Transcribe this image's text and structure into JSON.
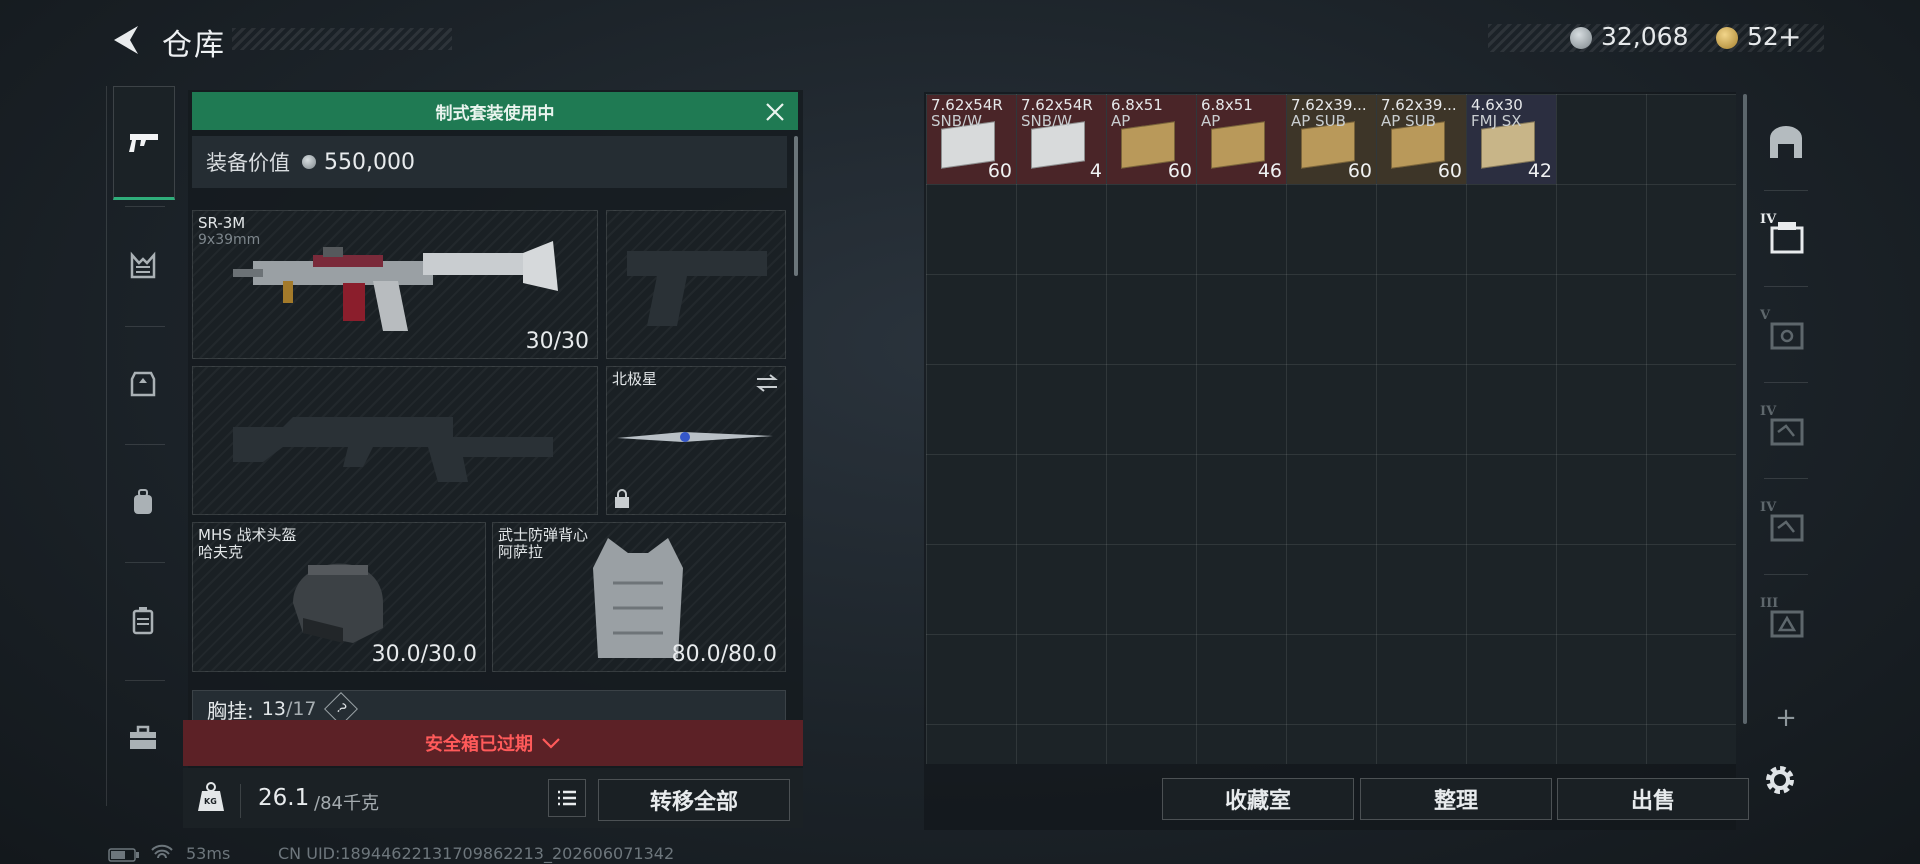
{
  "header": {
    "title": "仓库"
  },
  "currency": {
    "silver": "32,068",
    "gold": "52",
    "gold_add": "+"
  },
  "loadout": {
    "banner": "制式套装使用中",
    "value_label": "装备价值",
    "value": "550,000",
    "primary": {
      "name": "SR-3M",
      "caliber": "9x39mm",
      "ammo": "30/30"
    },
    "melee": {
      "name": "北极星"
    },
    "helmet": {
      "name": "MHS 战术头盔",
      "sub": "哈夫克",
      "durability": "30.0/30.0"
    },
    "armor": {
      "name": "武士防弹背心",
      "sub": "阿萨拉",
      "durability": "80.0/80.0"
    },
    "chest_rig": {
      "label": "胸挂:",
      "used": "13",
      "capacity": "/17",
      "help": "?"
    },
    "safebox_warning": "安全箱已过期",
    "weight": {
      "current": "26.1",
      "max": "/84千克",
      "icon_text": "KG"
    },
    "transfer_all": "转移全部"
  },
  "stash": {
    "items": [
      {
        "name": "7.62x54R",
        "sub": "SNB/W",
        "count": "60",
        "bg": "#4a2528"
      },
      {
        "name": "7.62x54R",
        "sub": "SNB/W",
        "count": "4",
        "bg": "#4a2528"
      },
      {
        "name": "6.8x51",
        "sub": "AP",
        "count": "60",
        "bg": "#4a2528"
      },
      {
        "name": "6.8x51",
        "sub": "AP",
        "count": "46",
        "bg": "#4a2528"
      },
      {
        "name": "7.62x39...",
        "sub": "AP SUB",
        "count": "60",
        "bg": "#3d3528"
      },
      {
        "name": "7.62x39...",
        "sub": "AP SUB",
        "count": "60",
        "bg": "#3d3528"
      },
      {
        "name": "4.6x30",
        "sub": "FMJ SX",
        "count": "42",
        "bg": "#2b2e40"
      }
    ],
    "buttons": {
      "collection": "收藏室",
      "sort": "整理",
      "sell": "出售"
    }
  },
  "right_nav": {
    "tiers": [
      "IV",
      "V",
      "IV",
      "IV",
      "III"
    ],
    "add": "+"
  },
  "status_bar": {
    "ping": "53ms",
    "uid": "CN UID:18944622131709862213_202606071342"
  },
  "colors": {
    "accent_green": "#1f7a53",
    "warning_red": "#ff5a5a"
  }
}
